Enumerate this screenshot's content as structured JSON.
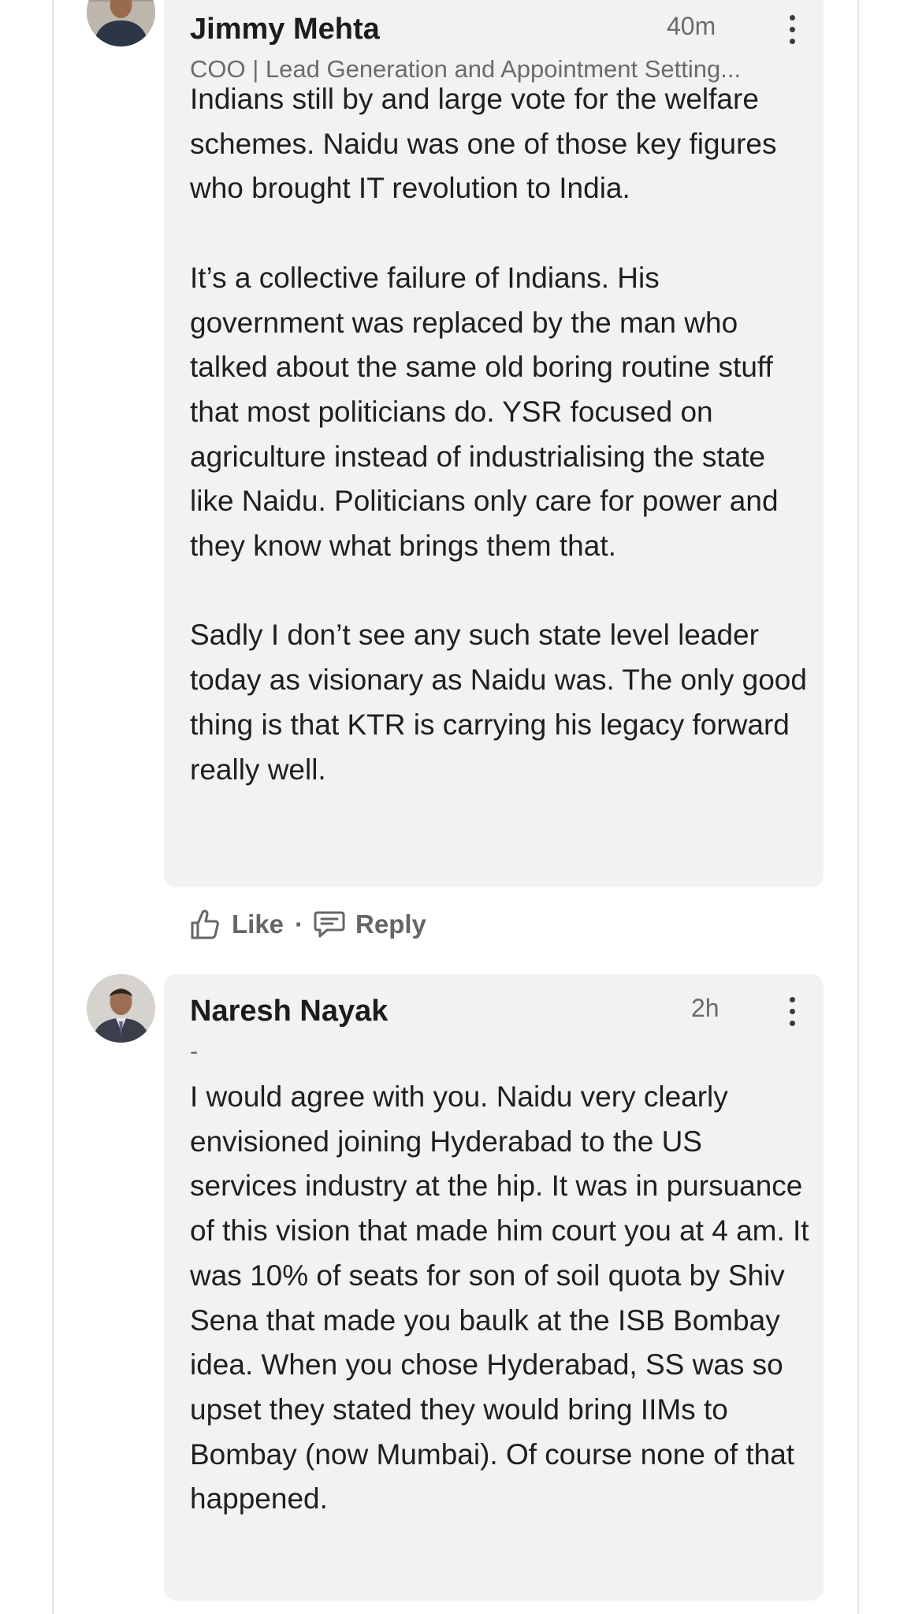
{
  "comments": [
    {
      "author": "Jimmy Mehta",
      "headline": "COO | Lead Generation and Appointment Setting...",
      "time": "40m",
      "paragraphs": [
        "Indians still by and large vote for the welfare schemes. Naidu was one of those key figures who brought IT revolution to India.",
        "It’s a collective failure of Indians. His government was replaced by the man who talked about the same old boring routine stuff that most politicians do. YSR focused on agriculture instead of industrialising the state like Naidu. Politicians only care for power and they know what brings them that.",
        "Sadly I don’t see any such state level leader today as visionary as Naidu was. The only good thing is that KTR is carrying his legacy forward really well."
      ],
      "actions": {
        "like": "Like",
        "separator": "·",
        "reply": "Reply"
      }
    },
    {
      "author": "Naresh Nayak",
      "headline": "-",
      "time": "2h",
      "paragraphs": [
        "I would agree with you. Naidu very clearly envisioned joining Hyderabad to the US services industry at the hip. It was in pursuance of this vision that made him court you at 4 am. It was 10% of seats for son of soil quota by Shiv Sena that made you baulk at the ISB Bombay idea. When you chose Hyderabad, SS was so upset they stated they would bring IIMs to Bombay (now Mumbai). Of course none of that happened."
      ]
    }
  ],
  "icons": {
    "more": "more-vertical-icon",
    "like": "thumbs-up-icon",
    "reply": "speech-bubble-icon"
  }
}
